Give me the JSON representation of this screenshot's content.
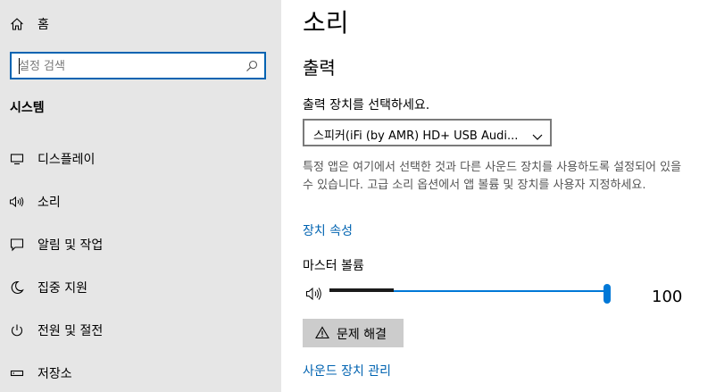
{
  "sidebar": {
    "home_label": "홈",
    "search_placeholder": "설정 검색",
    "section_label": "시스템",
    "items": [
      {
        "label": "디스플레이",
        "icon": "monitor-icon"
      },
      {
        "label": "소리",
        "icon": "speaker-icon"
      },
      {
        "label": "알림 및 작업",
        "icon": "notification-icon"
      },
      {
        "label": "집중 지원",
        "icon": "moon-icon"
      },
      {
        "label": "전원 및 절전",
        "icon": "power-icon"
      },
      {
        "label": "저장소",
        "icon": "storage-icon"
      }
    ]
  },
  "main": {
    "title": "소리",
    "output_section": "출력",
    "device_label": "출력 장치를 선택하세요.",
    "device_selected": "스피커(iFi (by AMR) HD+ USB Audi...",
    "description": "특정 앱은 여기에서 선택한 것과 다른 사운드 장치를 사용하도록 설정되어 있을 수 있습니다. 고급 소리 옵션에서 앱 볼륨 및 장치를 사용자 지정하세요.",
    "device_properties_link": "장치 속성",
    "master_volume_label": "마스터 볼륨",
    "master_volume_value": "100",
    "volume_level": 1.0,
    "troubleshoot_label": "문제 해결",
    "manage_devices_link": "사운드 장치 관리"
  },
  "colors": {
    "accent": "#0078d7",
    "link": "#0063b1",
    "sidebar_bg": "#e6e6e6"
  }
}
